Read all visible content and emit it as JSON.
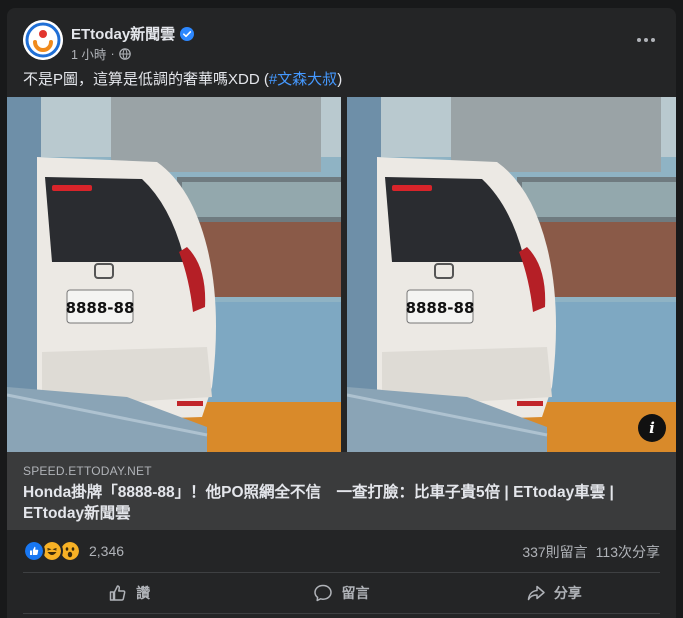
{
  "post": {
    "page_name": "ETtoday新聞雲",
    "time": "1 小時",
    "caption_text": "不是P圖，這算是低調的奢華嗎XDD (",
    "caption_tag": "#文森大叔",
    "caption_end": ")"
  },
  "media": {
    "plate_left": "8888-88",
    "plate_right": "8888-88"
  },
  "link": {
    "domain": "SPEED.ETTODAY.NET",
    "title": "Honda掛牌「8888-88」！他PO照網全不信　一查打臉：比車子貴5倍 | ETtoday車雲 | ETtoday新聞雲"
  },
  "stats": {
    "reaction_count": "2,346",
    "comments": "337則留言",
    "shares": "113次分享"
  },
  "actions": {
    "like": "讚",
    "comment": "留言",
    "share": "分享"
  },
  "colors": {
    "card_bg": "#242526",
    "link_bg": "#3a3b3c",
    "accent": "#4599ff",
    "text_secondary": "#b0b3b8"
  }
}
